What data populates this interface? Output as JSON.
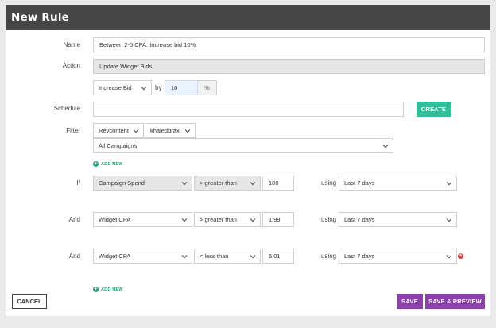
{
  "header": {
    "title": "New Rule"
  },
  "form": {
    "name_label": "Name",
    "name_value": "Between 2-5 CPA: Increase bid 10%",
    "action_label": "Action",
    "action_value": "Update Widget Bids",
    "bid_action": "Increase Bid",
    "by_label": "by",
    "bid_amount": "10",
    "bid_unit": "%",
    "schedule_label": "Schedule",
    "schedule_value": "",
    "create_label": "CREATE",
    "filter_label": "Filter",
    "filter_network": "Revcontent",
    "filter_account": "khaledbrax",
    "filter_campaigns": "All Campaigns",
    "add_new_filter": "ADD NEW"
  },
  "conditions": [
    {
      "connector": "If",
      "metric": "Campaign Spend",
      "operator": "> greater than",
      "value": "100",
      "using_label": "using",
      "range": "Last 7 days",
      "metric_gray": true
    },
    {
      "connector": "And",
      "metric": "Widget CPA",
      "operator": "> greater than",
      "value": "1.99",
      "using_label": "using",
      "range": "Last 7 days"
    },
    {
      "connector": "And",
      "metric": "Widget CPA",
      "operator": "< less than",
      "value": "5.01",
      "using_label": "using",
      "range": "Last 7 days",
      "removable": true
    }
  ],
  "add_new_condition": "ADD NEW",
  "footer": {
    "cancel_label": "CANCEL",
    "save_label": "SAVE",
    "save_preview_label": "SAVE & PREVIEW"
  },
  "colors": {
    "header_bg": "#464646",
    "create_button": "#2fbf9b",
    "add_new": "#1aa07a",
    "primary_button": "#8e3fae",
    "remove_icon": "#d64040"
  },
  "icons": [
    "chevron-down-icon",
    "plus-circle-icon",
    "close-circle-icon"
  ]
}
